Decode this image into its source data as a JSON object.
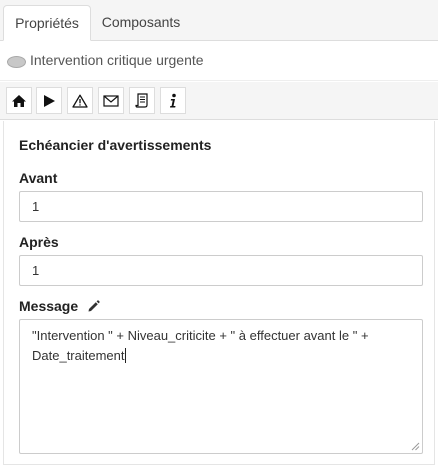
{
  "tabs": [
    {
      "label": "Propriétés",
      "active": true
    },
    {
      "label": "Composants",
      "active": false
    }
  ],
  "header": {
    "title": "Intervention critique urgente"
  },
  "toolbar": {
    "buttons": [
      "home-icon",
      "play-icon",
      "warning-icon",
      "mail-icon",
      "script-icon",
      "info-icon"
    ]
  },
  "form": {
    "section_title": "Echéancier d'avertissements",
    "avant_label": "Avant",
    "avant_value": "1",
    "apres_label": "Après",
    "apres_value": "1",
    "message_label": "Message",
    "message_line1": "\"Intervention \" +  Niveau_criticite + \" à effectuer avant le \" +",
    "message_line2": "Date_traitement"
  }
}
